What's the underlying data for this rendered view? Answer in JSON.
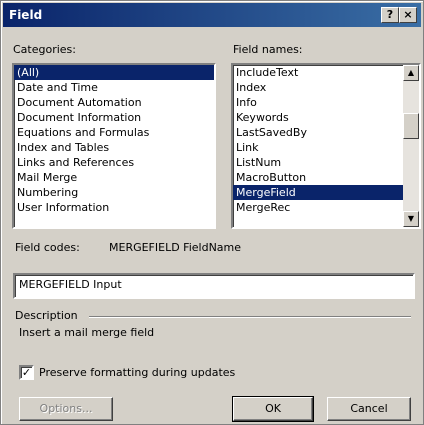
{
  "window": {
    "title": "Field",
    "help_label": "?",
    "close_label": "×"
  },
  "categories": {
    "label": "Categories:",
    "items": [
      "(All)",
      "Date and Time",
      "Document Automation",
      "Document Information",
      "Equations and Formulas",
      "Index and Tables",
      "Links and References",
      "Mail Merge",
      "Numbering",
      "User Information"
    ],
    "selected": "(All)"
  },
  "field_names": {
    "label": "Field names:",
    "items": [
      "IncludeText",
      "Index",
      "Info",
      "Keywords",
      "LastSavedBy",
      "Link",
      "ListNum",
      "MacroButton",
      "MergeField",
      "MergeRec"
    ],
    "selected": "MergeField",
    "scroll_up_icon": "▲",
    "scroll_down_icon": "▼"
  },
  "field_codes": {
    "label": "Field codes:",
    "syntax": "MERGEFIELD FieldName",
    "value": "MERGEFIELD Input"
  },
  "description": {
    "label": "Description",
    "text": "Insert a mail merge field"
  },
  "preserve_formatting": {
    "label": "Preserve formatting during updates",
    "checked": true,
    "check_mark": "✓"
  },
  "buttons": {
    "options": "Options...",
    "ok": "OK",
    "cancel": "Cancel"
  },
  "colors": {
    "title_bar": "#0a246a",
    "selection": "#0a246a",
    "face": "#d4d0c8"
  }
}
